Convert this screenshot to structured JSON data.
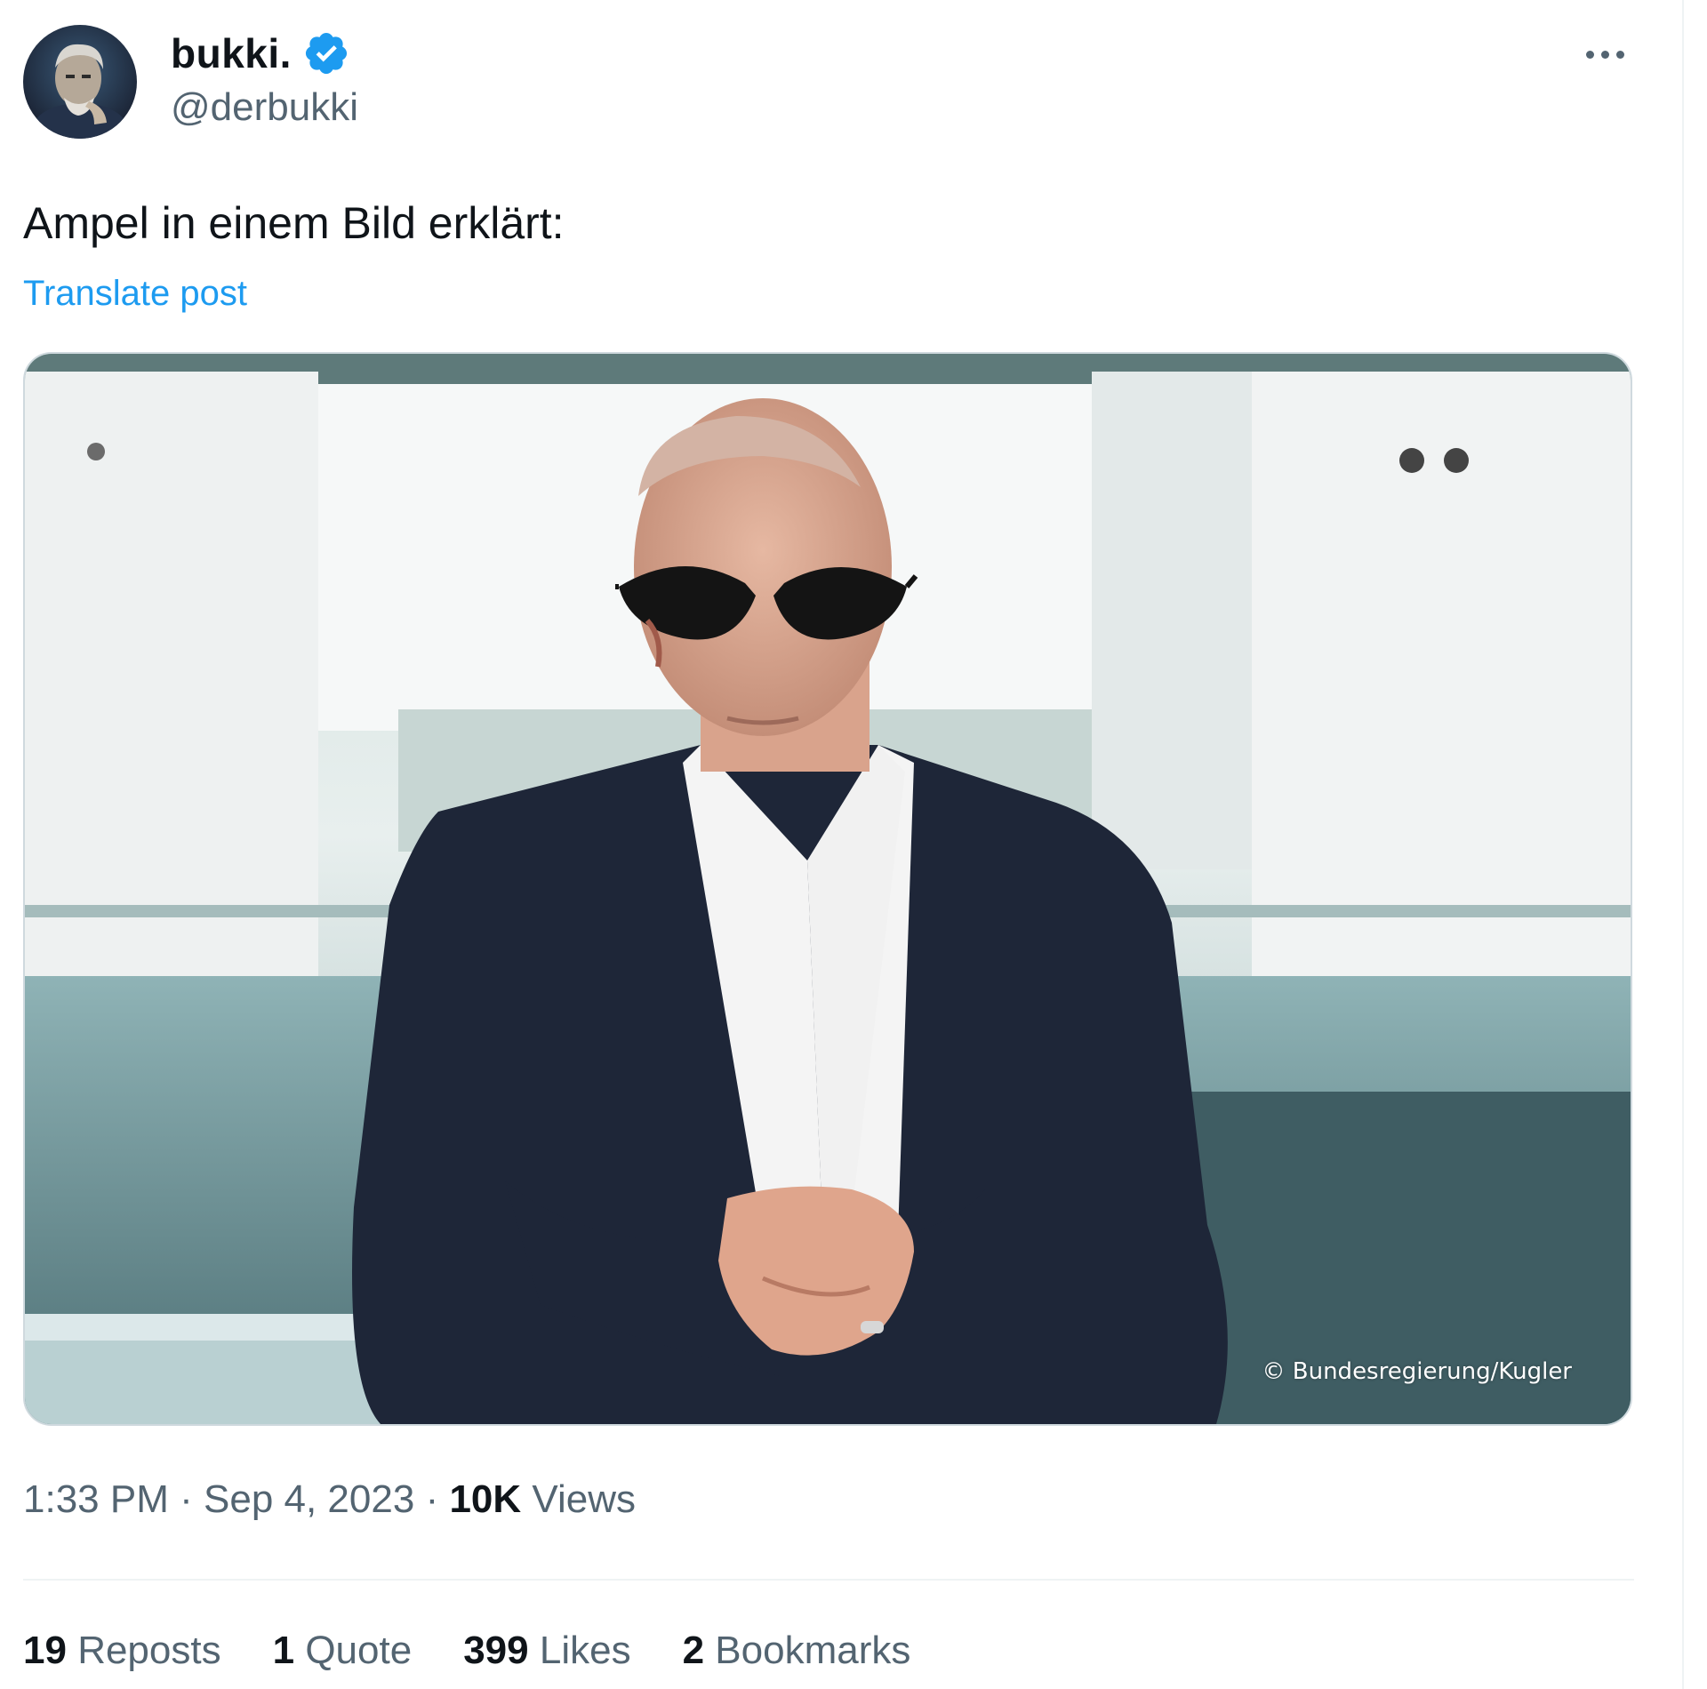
{
  "author": {
    "display_name": "bukki.",
    "handle": "@derbukki",
    "verified": true
  },
  "post": {
    "text": "Ampel in einem Bild erklärt:",
    "translate_label": "Translate post",
    "photo_credit": "© Bundesregierung/Kugler"
  },
  "meta": {
    "time": "1:33 PM",
    "date": "Sep 4, 2023",
    "views_count": "10K",
    "views_label": "Views"
  },
  "stats": {
    "reposts_count": "19",
    "reposts_label": "Reposts",
    "quotes_count": "1",
    "quotes_label": "Quote",
    "likes_count": "399",
    "likes_label": "Likes",
    "bookmarks_count": "2",
    "bookmarks_label": "Bookmarks"
  },
  "colors": {
    "accent": "#1d9bf0",
    "text_primary": "#0f1419",
    "text_secondary": "#536471",
    "divider": "#eff3f4"
  },
  "icons": {
    "verified": "verified-badge-icon",
    "more": "more-horizontal-icon"
  }
}
